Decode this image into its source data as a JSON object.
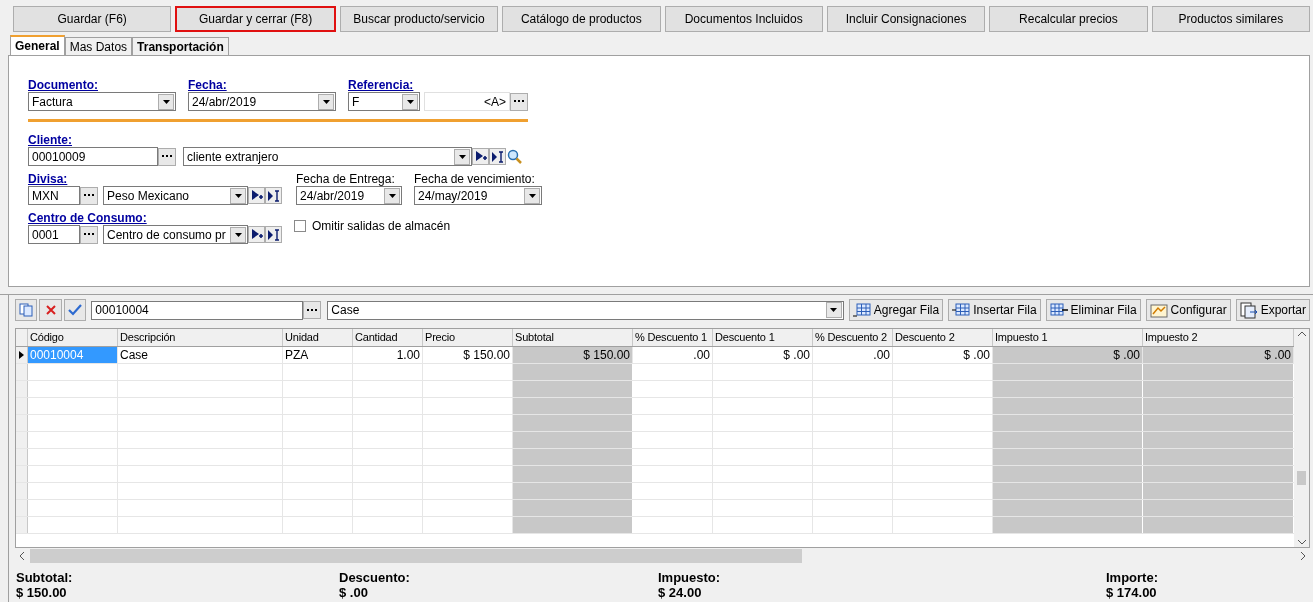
{
  "toolbar": [
    {
      "label": "Guardar (F6)",
      "focused": false
    },
    {
      "label": "Guardar y cerrar (F8)",
      "focused": true
    },
    {
      "label": "Buscar producto/servicio",
      "focused": false
    },
    {
      "label": "Catálogo de productos",
      "focused": false
    },
    {
      "label": "Documentos Incluidos",
      "focused": false
    },
    {
      "label": "Incluir Consignaciones",
      "focused": false
    },
    {
      "label": "Recalcular precios",
      "focused": false
    },
    {
      "label": "Productos similares",
      "focused": false
    }
  ],
  "tabs": [
    {
      "label": "General",
      "selected": true
    },
    {
      "label": "Mas Datos",
      "selected": false
    },
    {
      "label": "Transportación",
      "selected": false
    }
  ],
  "form": {
    "documento": {
      "label": "Documento:",
      "value": "Factura"
    },
    "fecha": {
      "label": "Fecha:",
      "value": "24/abr/2019"
    },
    "referencia": {
      "label": "Referencia:",
      "value": "F",
      "suffix": "<A>"
    },
    "cliente": {
      "label": "Cliente:",
      "code": "00010009",
      "name": "cliente extranjero"
    },
    "divisa": {
      "label": "Divisa:",
      "code": "MXN",
      "name": "Peso Mexicano"
    },
    "fecha_entrega": {
      "label": "Fecha de Entrega:",
      "value": "24/abr/2019"
    },
    "fecha_vencimiento": {
      "label": "Fecha de vencimiento:",
      "value": "24/may/2019"
    },
    "centro": {
      "label": "Centro de Consumo:",
      "code": "0001",
      "name": "Centro de consumo pr"
    },
    "omitir": {
      "label": "Omitir salidas de almacén",
      "checked": false
    }
  },
  "grid_toolbar": {
    "code": "00010004",
    "description": "Case",
    "buttons": [
      {
        "label": "Agregar Fila",
        "kind": "add"
      },
      {
        "label": "Insertar Fila",
        "kind": "insert"
      },
      {
        "label": "Eliminar Fila",
        "kind": "delete"
      },
      {
        "label": "Configurar",
        "kind": "config"
      },
      {
        "label": "Exportar",
        "kind": "export"
      }
    ]
  },
  "table": {
    "columns": [
      {
        "label": "Código",
        "numeric": false,
        "readonly": false
      },
      {
        "label": "Descripción",
        "numeric": false,
        "readonly": false
      },
      {
        "label": "Unidad",
        "numeric": false,
        "readonly": false
      },
      {
        "label": "Cantidad",
        "numeric": true,
        "readonly": false
      },
      {
        "label": "Precio",
        "numeric": true,
        "readonly": false
      },
      {
        "label": "Subtotal",
        "numeric": true,
        "readonly": true
      },
      {
        "label": "% Descuento 1",
        "numeric": true,
        "readonly": false
      },
      {
        "label": "Descuento 1",
        "numeric": true,
        "readonly": false
      },
      {
        "label": "% Descuento 2",
        "numeric": true,
        "readonly": false
      },
      {
        "label": "Descuento 2",
        "numeric": true,
        "readonly": false
      },
      {
        "label": "Impuesto 1",
        "numeric": true,
        "readonly": true
      },
      {
        "label": "Impuesto 2",
        "numeric": true,
        "readonly": true
      }
    ],
    "rows": [
      {
        "selected": true,
        "cells": [
          "00010004",
          "Case",
          "PZA",
          "1.00",
          "$ 150.00",
          "$ 150.00",
          ".00",
          "$ .00",
          ".00",
          "$ .00",
          "$ .00",
          "$ .00"
        ]
      }
    ]
  },
  "totals": [
    {
      "label": "Subtotal:",
      "value": "$ 150.00"
    },
    {
      "label": "Descuento:",
      "value": "$ .00"
    },
    {
      "label": "Impuesto:",
      "value": "$ 24.00"
    },
    {
      "label": "Importe:",
      "value": "$ 174.00"
    }
  ]
}
